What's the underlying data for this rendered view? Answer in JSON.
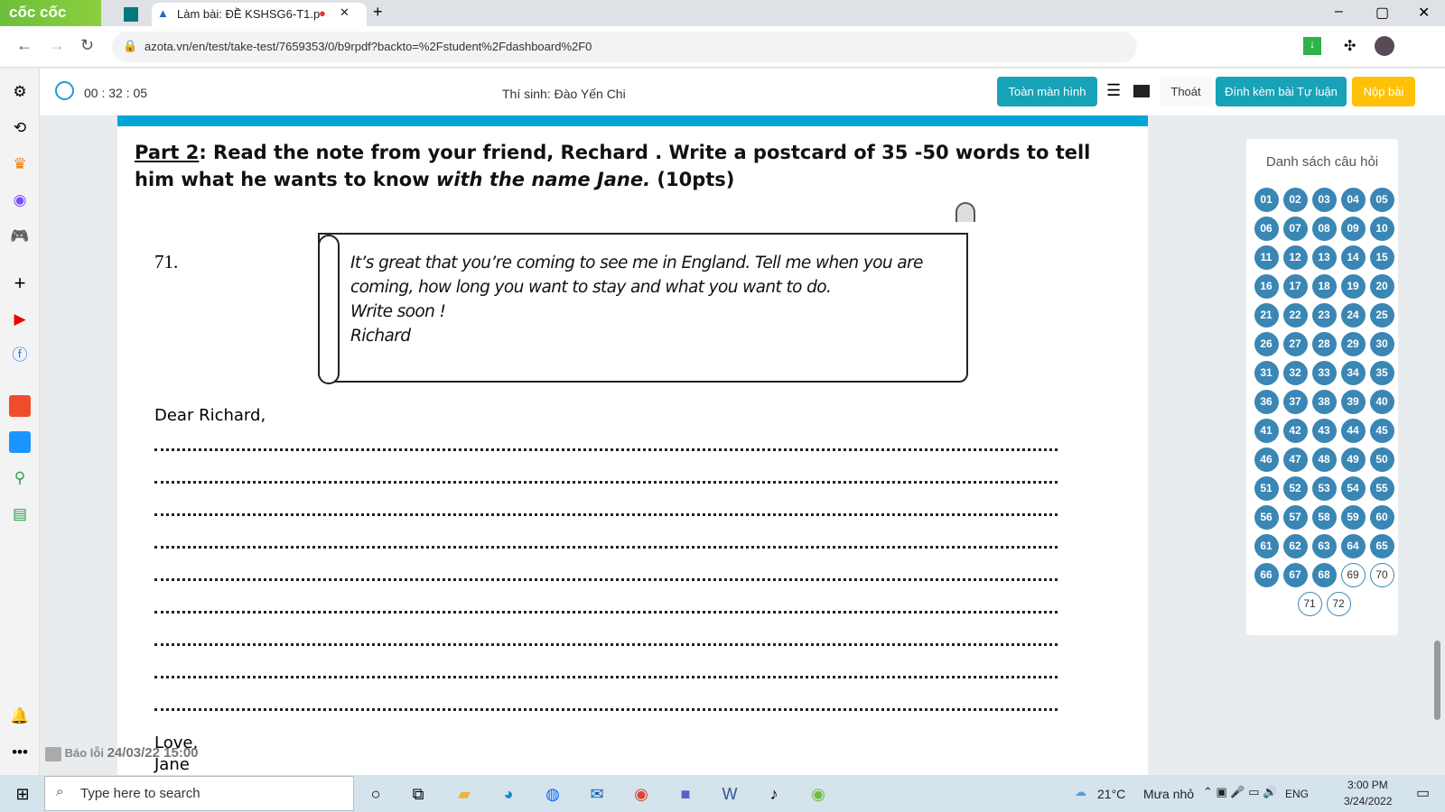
{
  "browser": {
    "brand": "cốc cốc",
    "active_tab_title": "Làm bài: ĐỀ KSHSG6-T1.p",
    "url": "azota.vn/en/test/take-test/7659353/0/b9rpdf?backto=%2Fstudent%2Fdashboard%2F0"
  },
  "header": {
    "timer": "00 : 32 : 05",
    "student": "Thí sinh: Đào Yến Chi",
    "fullscreen": "Toàn màn hình",
    "exit": "Thoát",
    "attach": "Đính kèm bài Tự luận",
    "submit": "Nộp bài"
  },
  "colors": {
    "accent": "#17a2b8",
    "submit": "#ffc107",
    "answered": "#3a86b4",
    "strip": "#00a6d6"
  },
  "question": {
    "part_label": "Part 2",
    "title_rest": ": Read the note from your friend, Rechard . Write a postcard of 35 -50 words to tell him what he wants to know ",
    "title_italic": "with the name Jane.",
    "title_end": " (10pts)",
    "number": "71.",
    "note": [
      "It’s great that you’re coming to see me in England. Tell me when you are",
      "coming, how long you want to stay and what you want to do.",
      "Write soon !",
      "Richard"
    ],
    "greeting": "Dear Richard,",
    "closing": "Love,",
    "signature": "Jane"
  },
  "report": {
    "label": "Báo lỗi",
    "timestamp": "24/03/22 15:00"
  },
  "panel": {
    "title": "Danh sách câu hỏi",
    "answered": [
      "01",
      "02",
      "03",
      "04",
      "05",
      "06",
      "07",
      "08",
      "09",
      "10",
      "11",
      "12",
      "13",
      "14",
      "15",
      "16",
      "17",
      "18",
      "19",
      "20",
      "21",
      "22",
      "23",
      "24",
      "25",
      "26",
      "27",
      "28",
      "29",
      "30",
      "31",
      "32",
      "33",
      "34",
      "35",
      "36",
      "37",
      "38",
      "39",
      "40",
      "41",
      "42",
      "43",
      "44",
      "45",
      "46",
      "47",
      "48",
      "49",
      "50",
      "51",
      "52",
      "53",
      "54",
      "55",
      "56",
      "57",
      "58",
      "59",
      "60",
      "61",
      "62",
      "63",
      "64",
      "65",
      "66",
      "67",
      "68"
    ],
    "unanswered": [
      "69",
      "70",
      "71",
      "72"
    ]
  },
  "taskbar": {
    "search_placeholder": "Type here to search",
    "weather": "21°C",
    "weather_desc": "Mưa nhỏ",
    "lang": "ENG",
    "time": "3:00 PM",
    "date": "3/24/2022"
  }
}
